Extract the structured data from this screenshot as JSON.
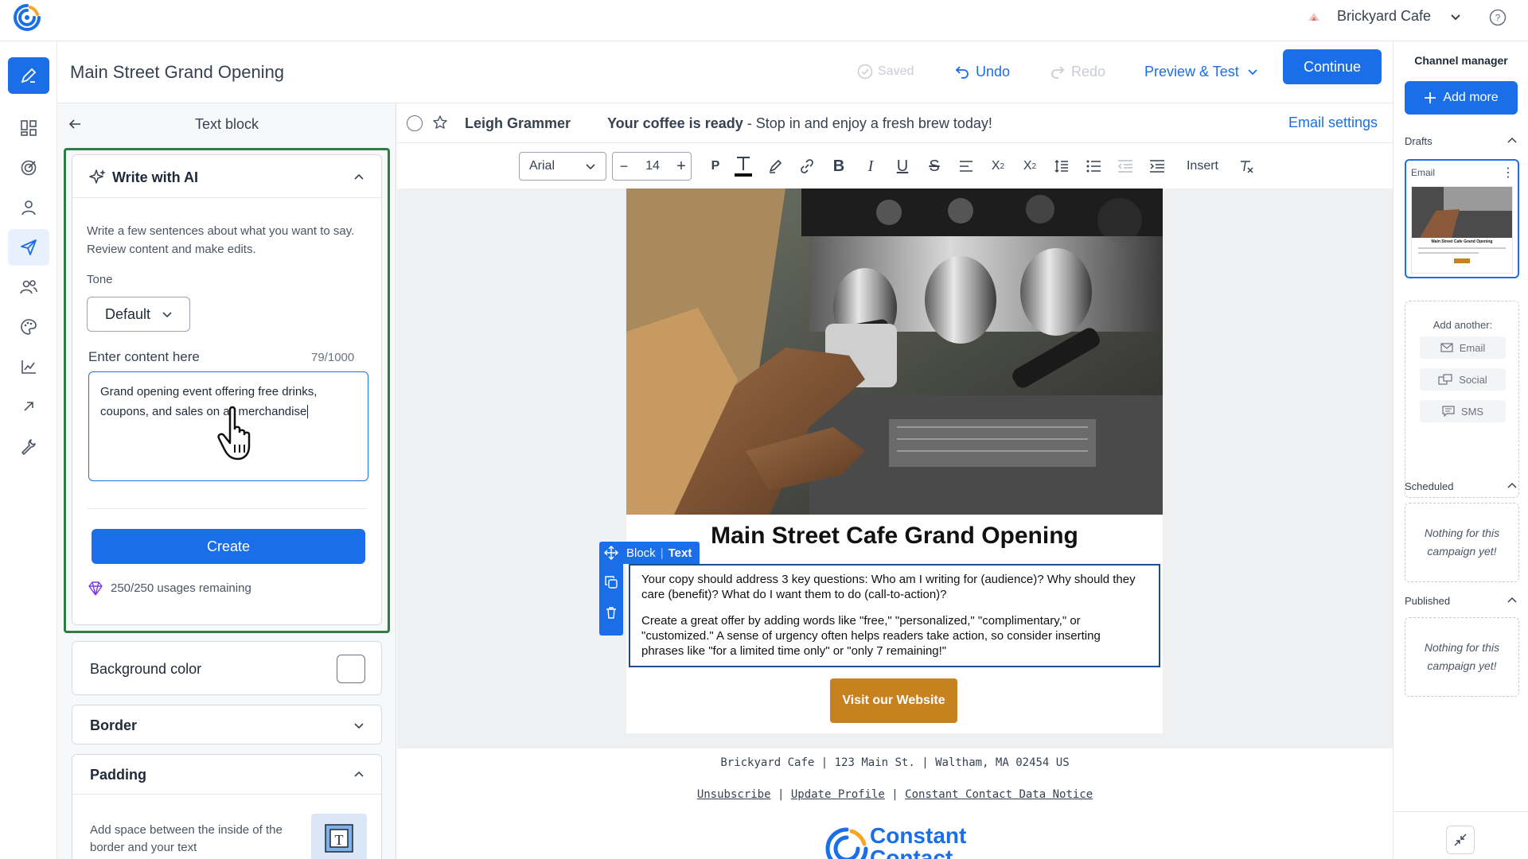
{
  "brand": {
    "accent": "#1a6fe8",
    "logo_icon": "constant-contact-logo-icon"
  },
  "account": {
    "name": "Brickyard Cafe"
  },
  "document": {
    "title": "Main Street Grand Opening"
  },
  "toolbar": {
    "saved_label": "Saved",
    "undo_label": "Undo",
    "redo_label": "Redo",
    "preview_label": "Preview & Test",
    "continue_label": "Continue"
  },
  "left_panel": {
    "title": "Text block",
    "ai": {
      "title": "Write with AI",
      "description": "Write a few sentences about what you want to say. Review content and make edits.",
      "tone_label": "Tone",
      "tone_value": "Default",
      "content_label": "Enter content here",
      "char_count": "79/1000",
      "content_value": "Grand opening event offering free drinks, coupons, and sales on all merchandise",
      "create_label": "Create",
      "usage": "250/250 usages remaining"
    },
    "background_label": "Background color",
    "border_label": "Border",
    "padding_label": "Padding",
    "padding_desc": "Add space between the inside of the border and your text"
  },
  "email_header": {
    "sender": "Leigh Grammer",
    "subject": "Your coffee is ready",
    "preheader": " - Stop in and enjoy a fresh brew today!",
    "settings_label": "Email settings"
  },
  "format_toolbar": {
    "font": "Arial",
    "size": "14",
    "paragraph": "P",
    "insert_label": "Insert"
  },
  "email": {
    "headline": "Main Street Cafe Grand Opening",
    "block_label": "Block",
    "block_type": "Text",
    "paragraph1": "Your copy should address 3 key questions: Who am I writing for (audience)? Why should they care (benefit)? What do I want them to do (call-to-action)?",
    "paragraph2": "Create a great offer by adding words like \"free,\" \"personalized,\" \"complimentary,\" or \"customized.\" A sense of urgency often helps readers take action, so consider inserting phrases like \"for a limited time only\" or \"only 7 remaining!\"",
    "button_label": "Visit our Website",
    "button_color": "#c8811f",
    "footer_address": "Brickyard Cafe | 123 Main St. | Waltham, MA 02454 US",
    "footer_links": [
      "Unsubscribe",
      "Update Profile",
      "Constant Contact Data Notice"
    ],
    "footer_logo_line1": "Constant",
    "footer_logo_line2": "Contact"
  },
  "channel_manager": {
    "title": "Channel manager",
    "add_more": "Add more",
    "drafts_label": "Drafts",
    "draft_card_label": "Email",
    "draft_thumb_caption": "Main Street Cafe Grand Opening",
    "add_another_label": "Add another:",
    "add_options": [
      "Email",
      "Social",
      "SMS"
    ],
    "scheduled_label": "Scheduled",
    "scheduled_empty": "Nothing for this campaign yet!",
    "published_label": "Published",
    "published_empty": "Nothing for this campaign yet!"
  }
}
